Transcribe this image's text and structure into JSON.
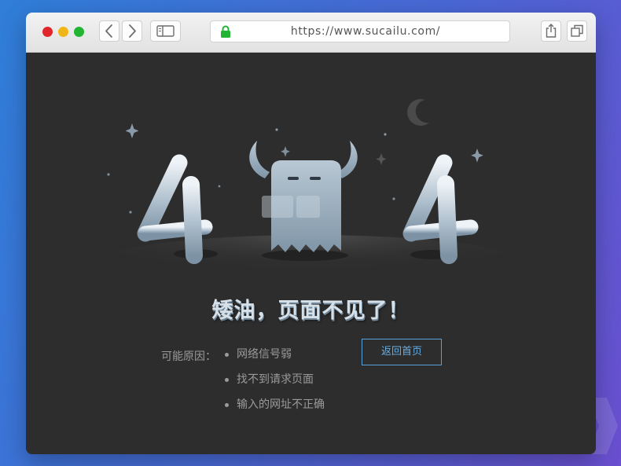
{
  "window": {
    "controls": [
      "close",
      "minimize",
      "zoom"
    ],
    "nav": {
      "back_icon": "chevron-left-icon",
      "forward_icon": "chevron-right-icon",
      "sidebar_icon": "sidebar-icon"
    },
    "address": {
      "secure_icon": "lock-icon",
      "url": "https://www.sucailu.com/"
    },
    "actions": {
      "share_icon": "share-icon",
      "tabs_icon": "tabs-icon"
    }
  },
  "error_page": {
    "code_digits": [
      "4",
      "4"
    ],
    "illustration": "ghost-with-horns",
    "heading": "矮油，页面不见了！",
    "reasons_label": "可能原因：",
    "reasons": [
      "网络信号弱",
      "找不到请求页面",
      "输入的网址不正确"
    ],
    "home_button_label": "返回首页"
  },
  "colors": {
    "background_gradient": [
      "#2f7ed8",
      "#6a4fcf"
    ],
    "page_bg": "#2d2d2d",
    "accent_button": "#5a9fd6",
    "muted_text": "#9a9a9a",
    "heading_text": "#d6e0e8"
  }
}
